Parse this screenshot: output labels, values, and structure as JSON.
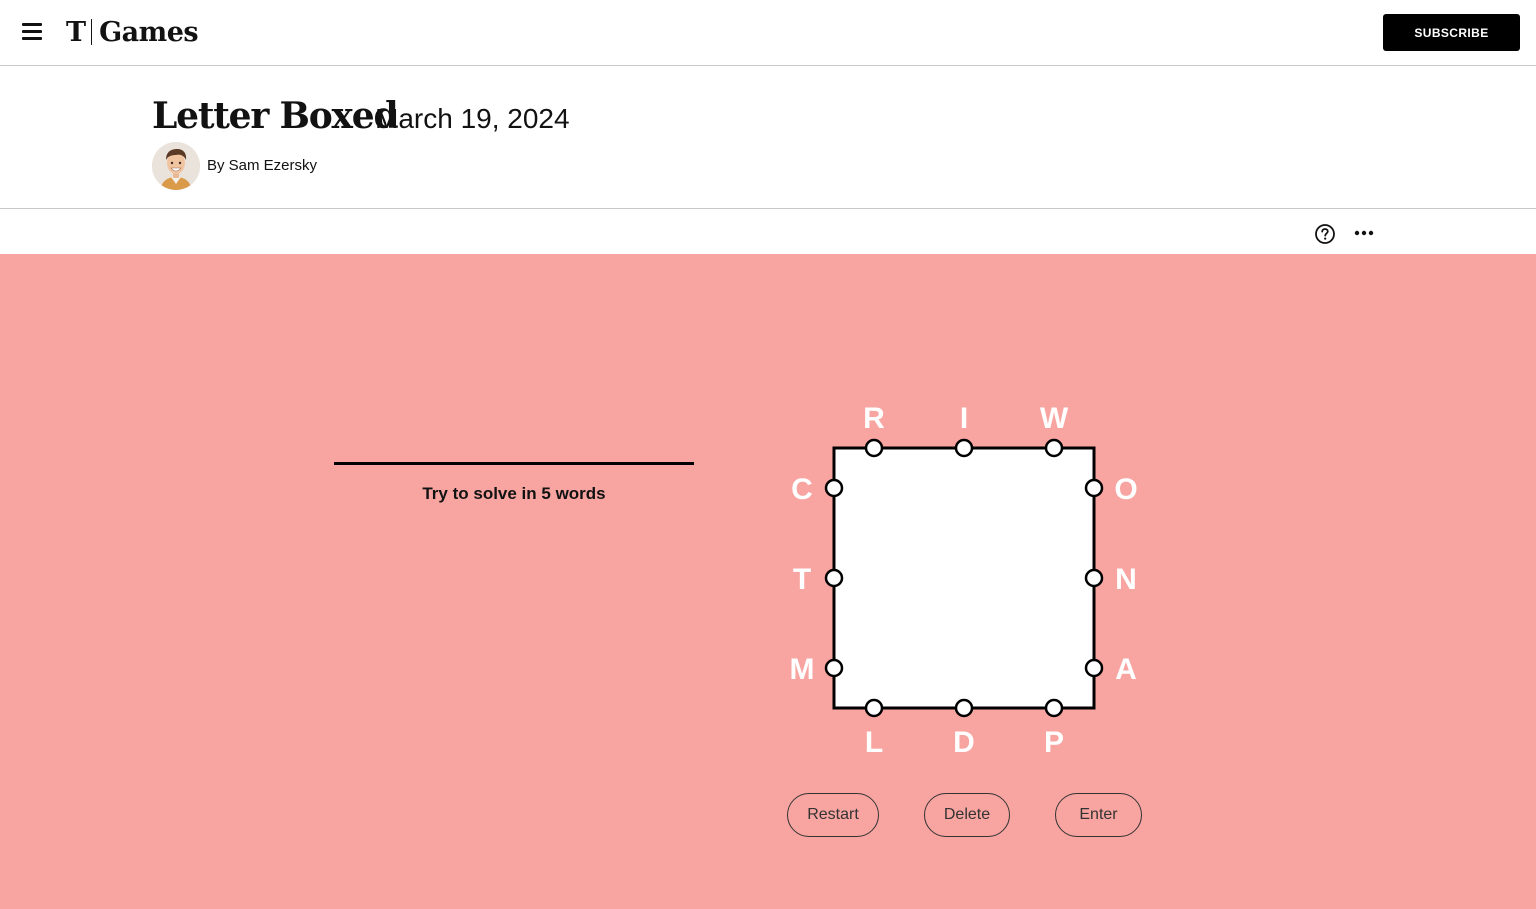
{
  "topbar": {
    "logo_mark": "T",
    "logo_text": "Games",
    "subscribe_label": "SUBSCRIBE"
  },
  "header": {
    "title": "Letter Boxed",
    "date": "March 19, 2024",
    "byline": "By Sam Ezersky"
  },
  "game": {
    "hint": "Try to solve in 5 words",
    "letters": {
      "top": [
        "R",
        "I",
        "W"
      ],
      "left": [
        "C",
        "T",
        "M"
      ],
      "right": [
        "O",
        "N",
        "A"
      ],
      "bottom": [
        "L",
        "D",
        "P"
      ]
    },
    "buttons": {
      "restart": "Restart",
      "delete": "Delete",
      "enter": "Enter"
    }
  },
  "colors": {
    "board_background": "#f8a5a2",
    "letter_color": "#ffffff",
    "box_fill": "#ffffff",
    "box_stroke": "#000000",
    "subscribe_background": "#000000"
  },
  "icons": {
    "menu": "hamburger-menu-icon",
    "help": "help-circle-icon",
    "more": "more-options-icon"
  }
}
